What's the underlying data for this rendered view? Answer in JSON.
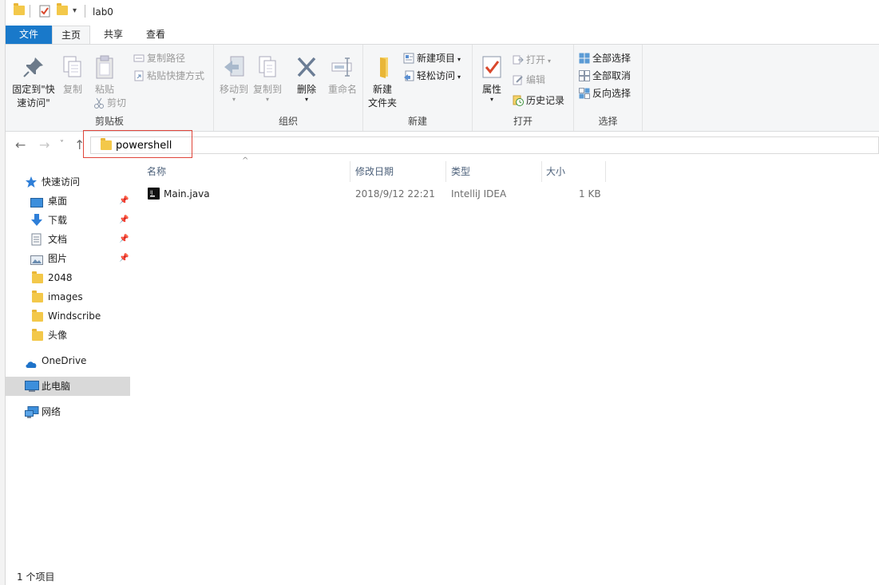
{
  "window": {
    "title": "lab0"
  },
  "ribbon_tabs": [
    "文件",
    "主页",
    "共享",
    "查看"
  ],
  "ribbon": {
    "clipboard": {
      "pin_label_line1": "固定到\"快",
      "pin_label_line2": "速访问\"",
      "copy": "复制",
      "paste": "粘贴",
      "copy_path": "复制路径",
      "paste_shortcut": "粘贴快捷方式",
      "cut": "剪切",
      "group": "剪贴板"
    },
    "organize": {
      "move_to": "移动到",
      "copy_to": "复制到",
      "delete": "删除",
      "rename": "重命名",
      "group": "组织"
    },
    "new": {
      "new_folder_line1": "新建",
      "new_folder_line2": "文件夹",
      "new_item": "新建项目",
      "easy_access": "轻松访问",
      "group": "新建"
    },
    "open": {
      "properties": "属性",
      "open": "打开",
      "edit": "编辑",
      "history": "历史记录",
      "group": "打开"
    },
    "select": {
      "select_all": "全部选择",
      "select_none": "全部取消",
      "invert": "反向选择",
      "group": "选择"
    }
  },
  "address": {
    "path_text": "powershell"
  },
  "nav_pane": {
    "quick_access": "快速访问",
    "items": [
      {
        "label": "桌面",
        "icon": "desktop-icon",
        "pinned": true
      },
      {
        "label": "下载",
        "icon": "download-icon",
        "pinned": true
      },
      {
        "label": "文档",
        "icon": "document-icon",
        "pinned": true
      },
      {
        "label": "图片",
        "icon": "pictures-icon",
        "pinned": true
      },
      {
        "label": "2048",
        "icon": "folder-icon",
        "pinned": false
      },
      {
        "label": "images",
        "icon": "folder-icon",
        "pinned": false
      },
      {
        "label": "Windscribe",
        "icon": "folder-icon",
        "pinned": false
      },
      {
        "label": "头像",
        "icon": "folder-icon",
        "pinned": false
      }
    ],
    "onedrive": "OneDrive",
    "this_pc": "此电脑",
    "network": "网络"
  },
  "columns": [
    "名称",
    "修改日期",
    "类型",
    "大小"
  ],
  "files": [
    {
      "name": "Main.java",
      "modified": "2018/9/12 22:21",
      "type": "IntelliJ IDEA",
      "size": "1 KB"
    }
  ],
  "status": {
    "count": "1 个项目"
  },
  "colors": {
    "file_tab": "#1979ca",
    "ribbon_bg": "#f5f6f7",
    "highlight_box": "#e0453a",
    "folder": "#f3c84a"
  }
}
